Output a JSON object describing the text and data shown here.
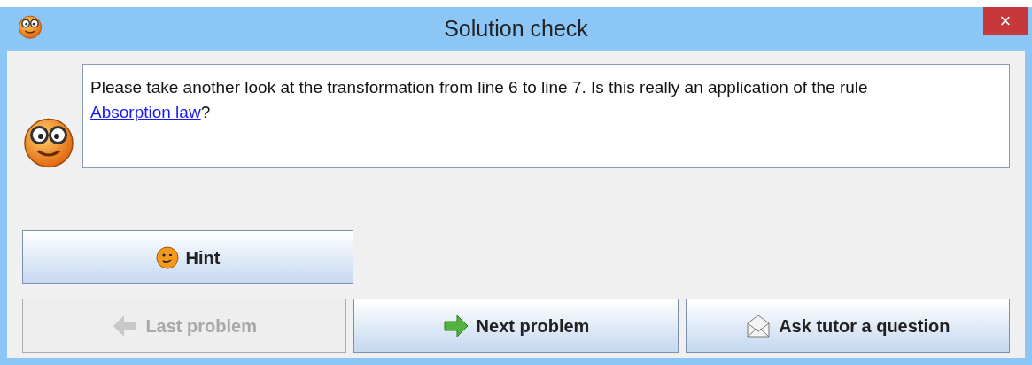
{
  "window": {
    "title": "Solution check",
    "close": "×"
  },
  "message": {
    "text": "Please take another look at the transformation from line 6 to line 7. Is this really an application of the rule ",
    "link": "Absorption law",
    "after": "?"
  },
  "hint_button": {
    "label": "Hint",
    "kind": "hint",
    "disabled": false
  },
  "buttons": [
    {
      "label": "Last problem",
      "kind": "back",
      "disabled": true
    },
    {
      "label": "Next problem",
      "kind": "next",
      "disabled": false
    },
    {
      "label": "Ask tutor a question",
      "kind": "mail",
      "disabled": false
    }
  ]
}
